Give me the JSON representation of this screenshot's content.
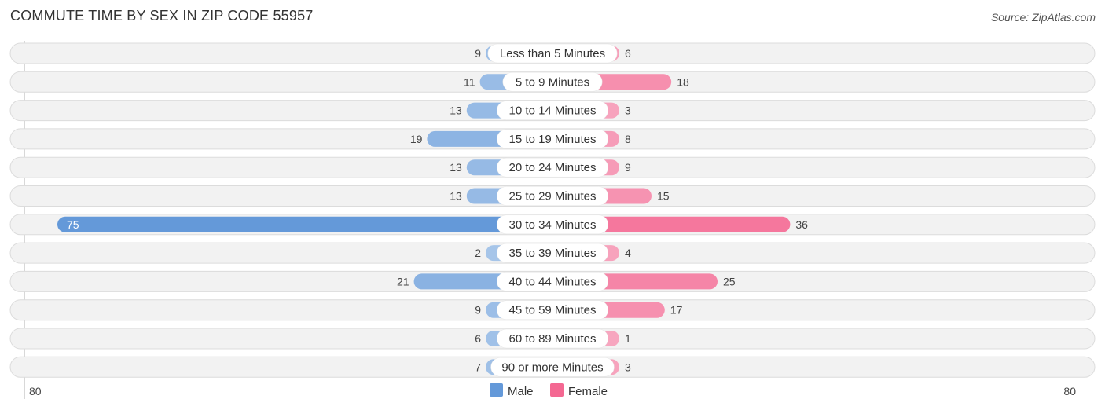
{
  "chart_data": {
    "type": "bar",
    "orientation": "horizontal-butterfly",
    "title": "COMMUTE TIME BY SEX IN ZIP CODE 55957",
    "source": "Source: ZipAtlas.com",
    "categories": [
      "Less than 5 Minutes",
      "5 to 9 Minutes",
      "10 to 14 Minutes",
      "15 to 19 Minutes",
      "20 to 24 Minutes",
      "25 to 29 Minutes",
      "30 to 34 Minutes",
      "35 to 39 Minutes",
      "40 to 44 Minutes",
      "45 to 59 Minutes",
      "60 to 89 Minutes",
      "90 or more Minutes"
    ],
    "series": [
      {
        "name": "Male",
        "color": "#6499d9",
        "light_color": "#a9c7ea",
        "values": [
          9,
          11,
          13,
          19,
          13,
          13,
          75,
          2,
          21,
          9,
          6,
          7
        ]
      },
      {
        "name": "Female",
        "color": "#f46892",
        "light_color": "#f7a7c0",
        "values": [
          6,
          18,
          3,
          8,
          9,
          15,
          36,
          4,
          25,
          17,
          1,
          3
        ]
      }
    ],
    "axis": {
      "left_label": "80",
      "right_label": "80",
      "max": 80
    },
    "legend": {
      "position": "bottom-center",
      "items": [
        "Male",
        "Female"
      ]
    },
    "grid": false
  }
}
